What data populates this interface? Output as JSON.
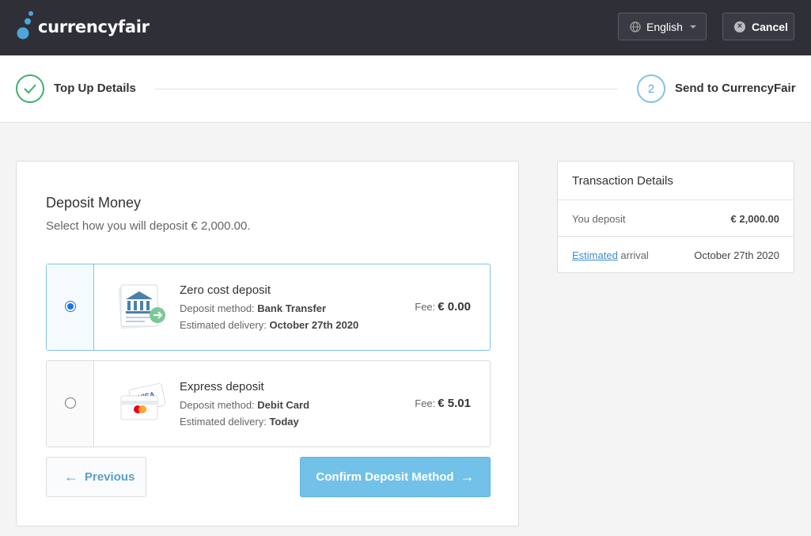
{
  "header": {
    "logo_text": "currencyfair",
    "language_label": "English",
    "cancel_label": "Cancel"
  },
  "stepper": {
    "step1_label": "Top Up Details",
    "step2_number": "2",
    "step2_label": "Send to CurrencyFair"
  },
  "deposit": {
    "title": "Deposit Money",
    "subtitle": "Select how you will deposit € 2,000.00.",
    "options": [
      {
        "title": "Zero cost deposit",
        "method_prefix": "Deposit method:",
        "method": "Bank Transfer",
        "delivery_prefix": "Estimated delivery:",
        "delivery": "October 27th 2020",
        "fee_prefix": "Fee:",
        "fee": "€ 0.00",
        "selected": true
      },
      {
        "title": "Express deposit",
        "method_prefix": "Deposit method:",
        "method": "Debit Card",
        "delivery_prefix": "Estimated delivery:",
        "delivery": "Today",
        "fee_prefix": "Fee:",
        "fee": "€ 5.01",
        "selected": false
      }
    ],
    "previous_label": "Previous",
    "confirm_label": "Confirm Deposit Method"
  },
  "transaction": {
    "title": "Transaction Details",
    "deposit_label": "You deposit",
    "deposit_value": "€ 2,000.00",
    "arrival_link": "Estimated",
    "arrival_label": " arrival",
    "arrival_value": "October 27th 2020"
  },
  "colors": {
    "header_bg": "#2f2f38",
    "accent_blue": "#72c1e8",
    "success_green": "#3fae6e"
  }
}
